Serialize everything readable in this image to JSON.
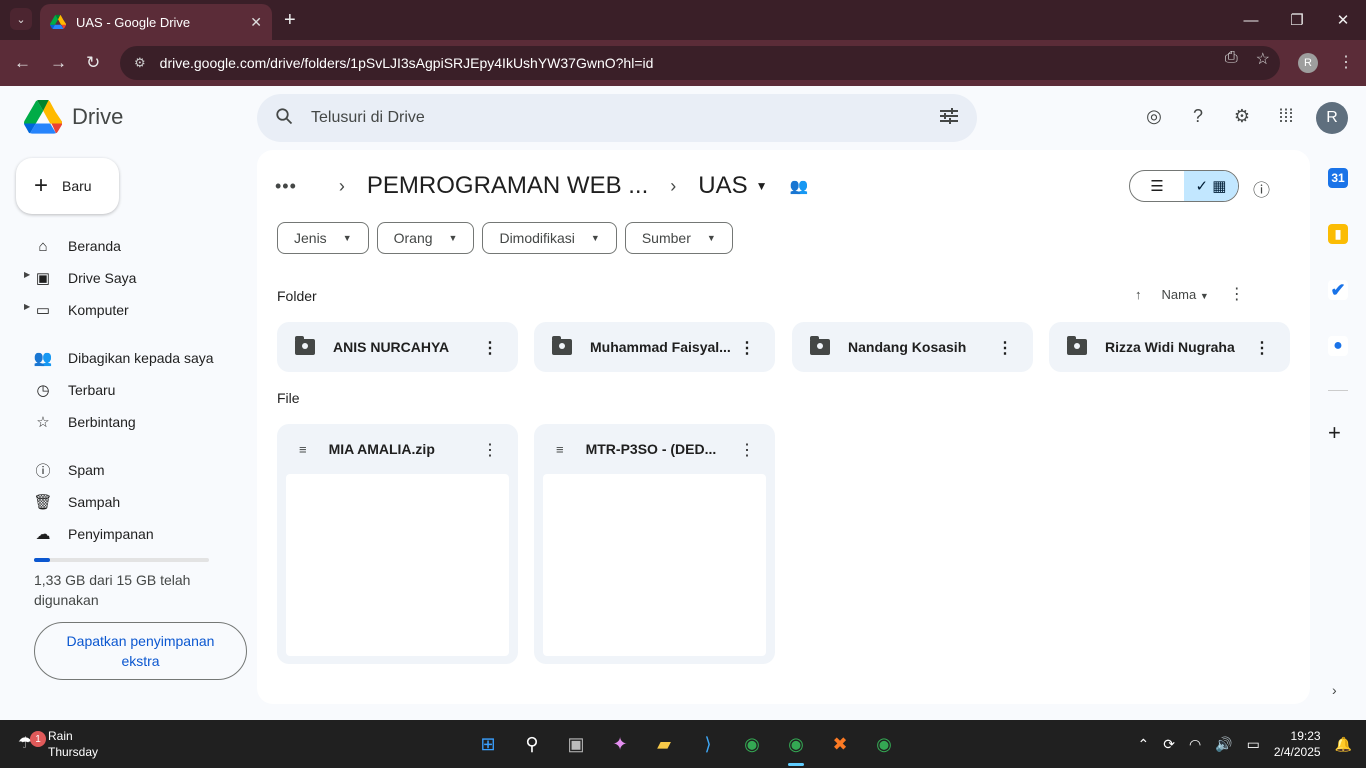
{
  "browser": {
    "tab_title": "UAS - Google Drive",
    "url": "drive.google.com/drive/folders/1pSvLJI3sAgpiSRJEpy4IkUshYW37GwnO?hl=id",
    "profile_initial": "R"
  },
  "drive": {
    "logo_text": "Drive",
    "search_placeholder": "Telusuri di Drive",
    "avatar_initial": "R",
    "new_label": "Baru",
    "nav": [
      {
        "label": "Beranda",
        "icon": "home-icon"
      },
      {
        "label": "Drive Saya",
        "icon": "my-drive-icon"
      },
      {
        "label": "Komputer",
        "icon": "computer-icon"
      },
      {
        "label": "Dibagikan kepada saya",
        "icon": "shared-icon"
      },
      {
        "label": "Terbaru",
        "icon": "clock-icon"
      },
      {
        "label": "Berbintang",
        "icon": "star-icon"
      },
      {
        "label": "Spam",
        "icon": "spam-icon"
      },
      {
        "label": "Sampah",
        "icon": "trash-icon"
      },
      {
        "label": "Penyimpanan",
        "icon": "cloud-icon"
      }
    ],
    "storage": {
      "text": "1,33 GB dari 15 GB telah digunakan",
      "fraction": 0.089,
      "cta": "Dapatkan penyimpanan ekstra"
    },
    "breadcrumb": {
      "parent": "PEMROGRAMAN WEB ...",
      "current": "UAS"
    },
    "filters": [
      "Jenis",
      "Orang",
      "Dimodifikasi",
      "Sumber"
    ],
    "folder_section": "Folder",
    "file_section": "File",
    "sort_label": "Nama",
    "folders": [
      "ANIS NURCAHYA",
      "Muhammad Faisyal...",
      "Nandang Kosasih",
      "Rizza Widi Nugraha"
    ],
    "files": [
      "MIA AMALIA.zip",
      "MTR-P3SO - (DED..."
    ]
  },
  "taskbar": {
    "weather_title": "Rain",
    "weather_sub": "Thursday",
    "weather_badge": "1",
    "time": "19:23",
    "date": "2/4/2025"
  },
  "colors": {
    "accent": "#0b57d0",
    "chrome": "#5b2c38"
  }
}
